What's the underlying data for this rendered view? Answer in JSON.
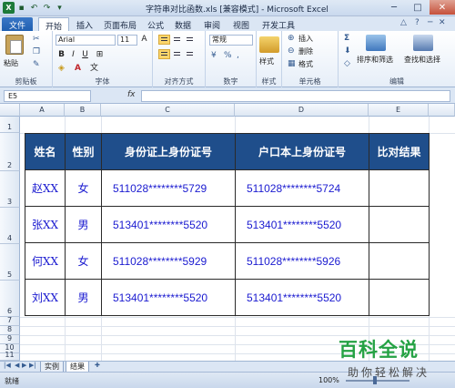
{
  "window": {
    "title": "字符串对比函数.xls [兼容模式] - Microsoft Excel"
  },
  "tabs": [
    "文件",
    "开始",
    "插入",
    "页面布局",
    "公式",
    "数据",
    "审阅",
    "视图",
    "开发工具"
  ],
  "ribbon": {
    "clipboard": {
      "label": "剪贴板",
      "paste": "粘贴"
    },
    "font": {
      "label": "字体",
      "name": "Arial",
      "size": "11"
    },
    "alignment": {
      "label": "对齐方式"
    },
    "number": {
      "label": "数字",
      "format": "常规"
    },
    "styles": {
      "label": "样式",
      "button": "样式"
    },
    "cells": {
      "label": "单元格",
      "insert": "插入",
      "delete": "删除",
      "format": "格式"
    },
    "editing": {
      "label": "编辑",
      "sort": "排序和筛选",
      "find": "查找和选择"
    }
  },
  "formula_bar": {
    "name_box": "E5",
    "fx": "fx",
    "content": ""
  },
  "columns": [
    "A",
    "B",
    "C",
    "D",
    "E"
  ],
  "rows": [
    "1",
    "2",
    "3",
    "4",
    "5",
    "6",
    "7",
    "8",
    "9",
    "10",
    "11"
  ],
  "table": {
    "headers": [
      "姓名",
      "性别",
      "身份证上身份证号",
      "户口本上身份证号",
      "比对结果"
    ],
    "rows": [
      [
        "赵XX",
        "女",
        "511028********5729",
        "511028********5724",
        ""
      ],
      [
        "张XX",
        "男",
        "513401********5520",
        "513401********5520",
        ""
      ],
      [
        "何XX",
        "女",
        "511028********5929",
        "511028********5926",
        ""
      ],
      [
        "刘XX",
        "男",
        "513401********5520",
        "513401********5520",
        ""
      ]
    ]
  },
  "sheets": [
    "实例",
    "结果"
  ],
  "status": {
    "ready": "就绪",
    "zoom": "100%"
  },
  "watermark": {
    "main": "百科全说",
    "sub": "助你轻松解决"
  },
  "colors": {
    "header_fill": "#1f4e8b",
    "data_text": "#1a1ad0",
    "brand_green": "#25a244"
  }
}
